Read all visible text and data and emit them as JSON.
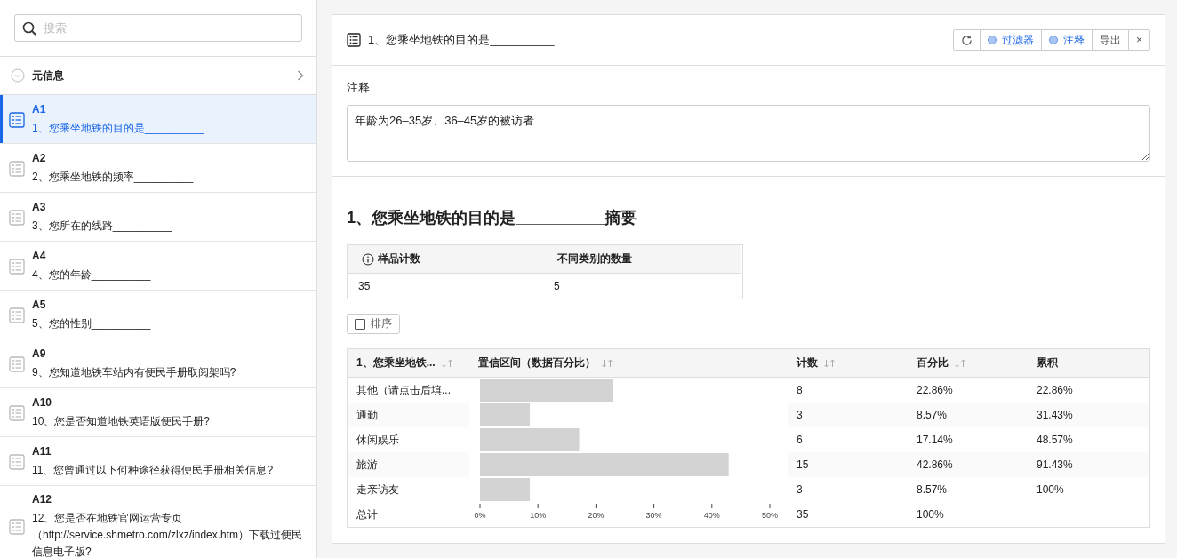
{
  "sidebar": {
    "search": {
      "placeholder": "搜索"
    },
    "meta": {
      "label": "元信息"
    },
    "items": [
      {
        "code": "A1",
        "title": "1、您乘坐地铁的目的是__________",
        "selected": true
      },
      {
        "code": "A2",
        "title": "2、您乘坐地铁的频率__________",
        "selected": false
      },
      {
        "code": "A3",
        "title": "3、您所在的线路__________",
        "selected": false
      },
      {
        "code": "A4",
        "title": "4、您的年龄__________",
        "selected": false
      },
      {
        "code": "A5",
        "title": "5、您的性别__________",
        "selected": false
      },
      {
        "code": "A9",
        "title": "9、您知道地铁车站内有便民手册取阅架吗?",
        "selected": false
      },
      {
        "code": "A10",
        "title": "10、您是否知道地铁英语版便民手册?",
        "selected": false
      },
      {
        "code": "A11",
        "title": "11、您曾通过以下何种途径获得便民手册相关信息?",
        "selected": false
      },
      {
        "code": "A12",
        "title": "12、您是否在地铁官网运营专页（http://service.shmetro.com/zlxz/index.htm）下载过便民信息电子版?",
        "selected": false
      }
    ]
  },
  "panel": {
    "title": "1、您乘坐地铁的目的是__________",
    "toolbar": [
      {
        "kind": "refresh"
      },
      {
        "kind": "toggle",
        "label": "过滤器"
      },
      {
        "kind": "toggle",
        "label": "注释"
      },
      {
        "kind": "text",
        "label": "导出"
      },
      {
        "kind": "text",
        "label": "×"
      }
    ],
    "notes": {
      "label": "注释",
      "value": "年龄为26–35岁、36–45岁的被访者"
    },
    "summary": {
      "heading": "1、您乘坐地铁的目的是__________摘要",
      "columns": [
        {
          "label": "样品计数",
          "info": true
        },
        {
          "label": "不同类别的数量",
          "info": false
        }
      ],
      "values": [
        "35",
        "5"
      ]
    },
    "sort": {
      "label": "排序",
      "checked": false
    },
    "table": {
      "columns": [
        {
          "label": "1、您乘坐地铁...",
          "sortable": true
        },
        {
          "label": "置信区间（数据百分比）",
          "sortable": true
        },
        {
          "label": "计数",
          "sortable": true
        },
        {
          "label": "百分比",
          "sortable": true
        },
        {
          "label": "累积",
          "sortable": false
        }
      ],
      "rows": [
        {
          "count": "8",
          "percent": "22.86%",
          "cumulative": "22.86%"
        },
        {
          "count": "3",
          "percent": "8.57%",
          "cumulative": "31.43%"
        },
        {
          "count": "6",
          "percent": "17.14%",
          "cumulative": "48.57%"
        },
        {
          "count": "15",
          "percent": "42.86%",
          "cumulative": "91.43%"
        },
        {
          "count": "3",
          "percent": "8.57%",
          "cumulative": "100%"
        }
      ],
      "total": {
        "label": "总计",
        "count": "35",
        "percent": "100%"
      },
      "chart_data": {
        "type": "bar",
        "orientation": "horizontal",
        "categories": [
          "其他（请点击后填...",
          "通勤",
          "休闲娱乐",
          "旅游",
          "走亲访友"
        ],
        "values": [
          22.9,
          8.6,
          17.1,
          42.9,
          8.6
        ],
        "xlim": [
          0,
          50
        ],
        "xticks": [
          {
            "value": 0,
            "label": "0%"
          },
          {
            "value": 10,
            "label": "10%"
          },
          {
            "value": 20,
            "label": "20%"
          },
          {
            "value": 30,
            "label": "30%"
          },
          {
            "value": 40,
            "label": "40%"
          },
          {
            "value": 50,
            "label": "50%"
          }
        ]
      }
    }
  }
}
